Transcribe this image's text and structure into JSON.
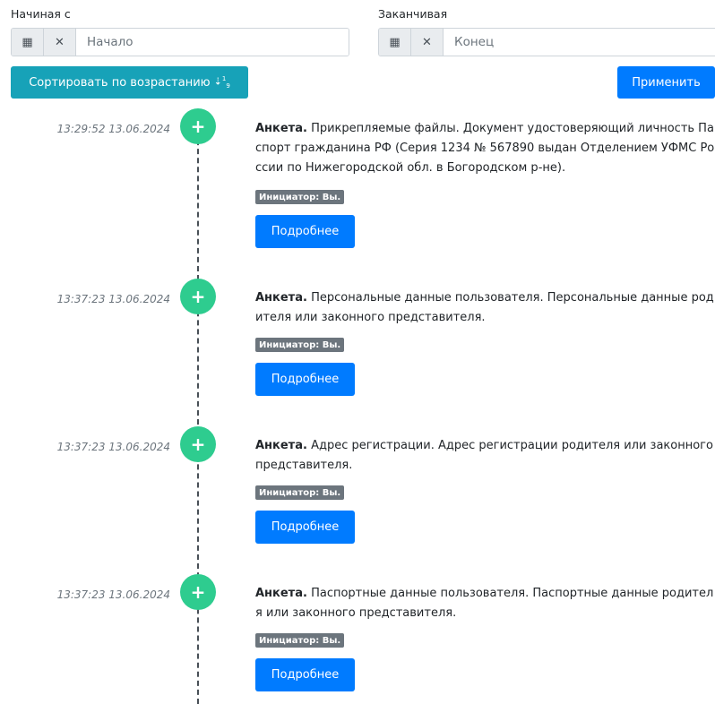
{
  "filter": {
    "from_label": "Начиная с",
    "from_placeholder": "Начало",
    "to_label": "Заканчивая",
    "to_placeholder": "Конец",
    "sort_button_label": "Сортировать по возрастанию",
    "apply_button_label": "Применить",
    "icons": [
      "calendar-icon",
      "clear-icon",
      "sort-numeric-asc-icon"
    ]
  },
  "events": [
    {
      "time": "13:29:52 13.06.2024",
      "title": "Анкета.",
      "text": "Прикрепляемые файлы. Документ удостоверяющий личность Паспорт гражданина РФ (Серия 1234 № 567890 выдан Отделением УФМС России по Нижегородской обл. в Богородском р-не).",
      "initiator": "Инициатор: Вы.",
      "more_label": "Подробнее"
    },
    {
      "time": "13:37:23 13.06.2024",
      "title": "Анкета.",
      "text": "Персональные данные пользователя. Персональные данные родителя или законного представителя.",
      "initiator": "Инициатор: Вы.",
      "more_label": "Подробнее"
    },
    {
      "time": "13:37:23 13.06.2024",
      "title": "Анкета.",
      "text": "Адрес регистрации. Адрес регистрации родителя или законного представителя.",
      "initiator": "Инициатор: Вы.",
      "more_label": "Подробнее"
    },
    {
      "time": "13:37:23 13.06.2024",
      "title": "Анкета.",
      "text": "Паспортные данные пользователя. Паспортные данные родителя или законного представителя.",
      "initiator": "Инициатор: Вы.",
      "more_label": "Подробнее"
    }
  ],
  "colors": {
    "timeline_dot": "#2ecc8f",
    "primary": "#007bff",
    "sort_button": "#17a2b8",
    "badge": "#6c757d"
  }
}
